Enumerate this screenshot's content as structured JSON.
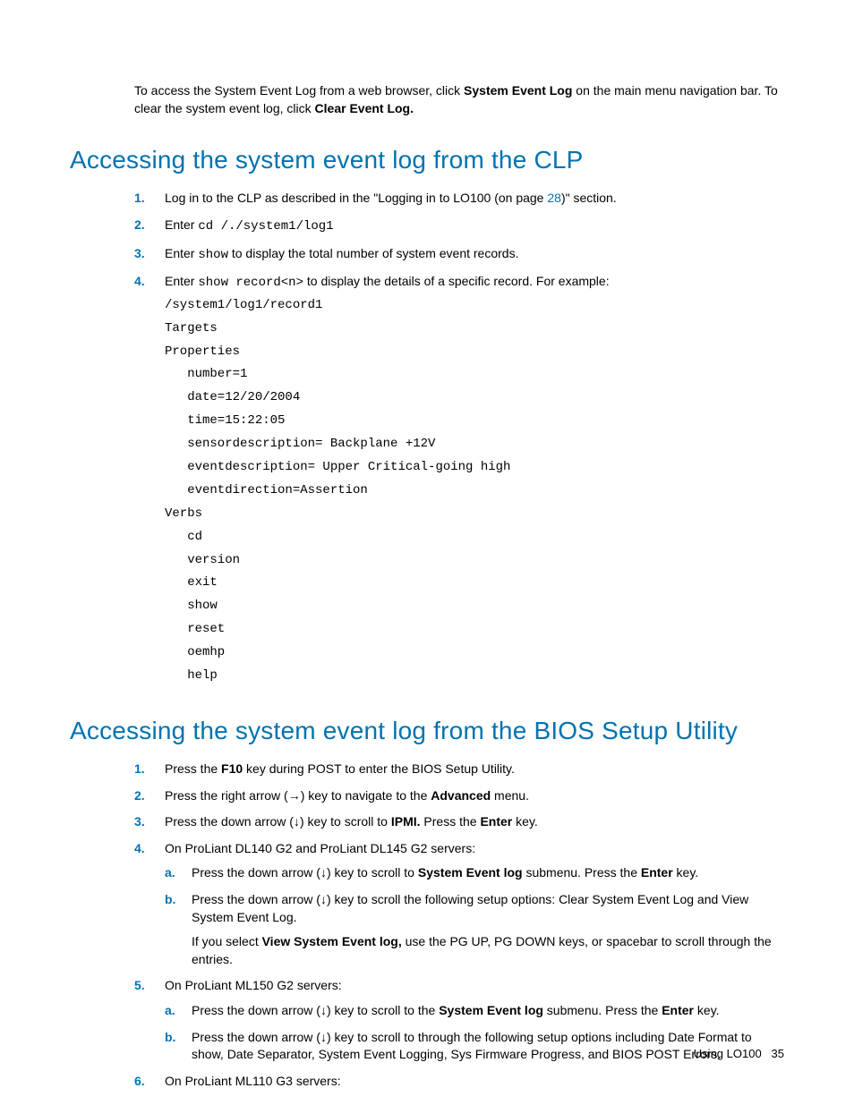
{
  "intro": {
    "p1a": "To access the System Event Log from a web browser, click ",
    "p1b": "System Event Log",
    "p1c": " on the main menu navigation bar. To clear the system event log, click ",
    "p1d": "Clear Event Log."
  },
  "heading1": "Accessing the system event log from the CLP",
  "clp": {
    "s1a": "Log in to the CLP as described in the \"Logging in to LO100 (on page ",
    "s1link": "28",
    "s1b": ")\" section.",
    "s2a": "Enter ",
    "s2code": "cd /./system1/log1",
    "s3a": "Enter ",
    "s3code": "show",
    "s3b": " to display the total number of system event records.",
    "s4a": "Enter ",
    "s4code": "show record<n>",
    "s4b": " to display the details of a specific record. For example:",
    "codeblock": "/system1/log1/record1\nTargets\nProperties\n   number=1\n   date=12/20/2004\n   time=15:22:05\n   sensordescription= Backplane +12V\n   eventdescription= Upper Critical-going high\n   eventdirection=Assertion\nVerbs\n   cd\n   version\n   exit\n   show\n   reset\n   oemhp\n   help"
  },
  "heading2": "Accessing the system event log from the BIOS Setup Utility",
  "bios": {
    "s1a": "Press the ",
    "s1b": "F10",
    "s1c": " key during POST to enter the BIOS Setup Utility.",
    "s2a": "Press the right arrow (→) key to navigate to the ",
    "s2b": "Advanced",
    "s2c": " menu.",
    "s3a": "Press the down arrow (↓) key to scroll to ",
    "s3b": "IPMI.",
    "s3c": " Press the ",
    "s3d": "Enter",
    "s3e": " key.",
    "s4": "On ProLiant DL140 G2 and ProLiant DL145 G2 servers:",
    "s4a1": "Press the down arrow (↓) key to scroll to ",
    "s4a2": "System Event log",
    "s4a3": " submenu. Press the ",
    "s4a4": "Enter",
    "s4a5": " key.",
    "s4b": "Press the down arrow (↓) key to scroll the following setup options: Clear System Event Log and View System Event Log.",
    "s4note1": "If you select ",
    "s4note2": "View System Event log,",
    "s4note3": " use the PG UP, PG DOWN keys, or spacebar to scroll through the entries.",
    "s5": "On ProLiant ML150 G2 servers:",
    "s5a1": "Press the down arrow (↓) key to scroll to the ",
    "s5a2": "System Event log",
    "s5a3": " submenu. Press the ",
    "s5a4": "Enter",
    "s5a5": " key.",
    "s5b": "Press the down arrow (↓) key to scroll to through the following setup options including Date Format to show, Date Separator, System Event Logging, Sys Firmware Progress, and BIOS POST Errors.",
    "s6": "On ProLiant ML110 G3 servers:"
  },
  "footer": {
    "section": "Using LO100",
    "page": "35"
  },
  "markers": {
    "n1": "1.",
    "n2": "2.",
    "n3": "3.",
    "n4": "4.",
    "n5": "5.",
    "n6": "6.",
    "a": "a.",
    "b": "b."
  }
}
